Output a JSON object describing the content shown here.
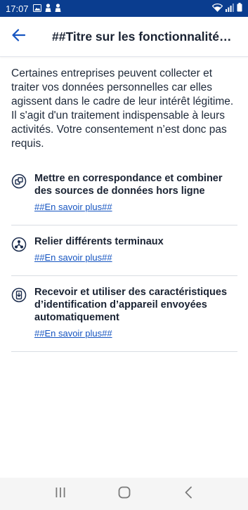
{
  "status_bar": {
    "time": "17:07",
    "icons": [
      "image-icon",
      "person-icon",
      "person-icon",
      "wifi-icon",
      "signal-icon",
      "battery-icon"
    ]
  },
  "app_bar": {
    "title": "##Titre sur les fonctionnalités spéciales##",
    "back_icon": "back-arrow-icon"
  },
  "intro": "Certaines entreprises peuvent collecter et traiter vos données personnelles car elles agissent dans le cadre de leur intérêt légitime. Il s'agit d'un traitement indispensable à leurs activités. Votre consentement n’est donc pas requis.",
  "purposes": [
    {
      "icon": "match-combine-icon",
      "title": "Mettre en correspondance et combiner des sources de données hors ligne",
      "link": "##En savoir plus##"
    },
    {
      "icon": "link-devices-icon",
      "title": "Relier différents terminaux",
      "link": "##En savoir plus##"
    },
    {
      "icon": "device-identification-icon",
      "title": "Recevoir et utiliser des caractéristiques d’identification d’appareil envoyées automatiquement",
      "link": "##En savoir plus##"
    }
  ],
  "nav_bar": {
    "icons": [
      "recent-apps-icon",
      "home-icon",
      "back-icon"
    ]
  },
  "colors": {
    "status_bar": "#0a3d8f",
    "accent": "#1655c1",
    "text": "#1f2a3a"
  }
}
